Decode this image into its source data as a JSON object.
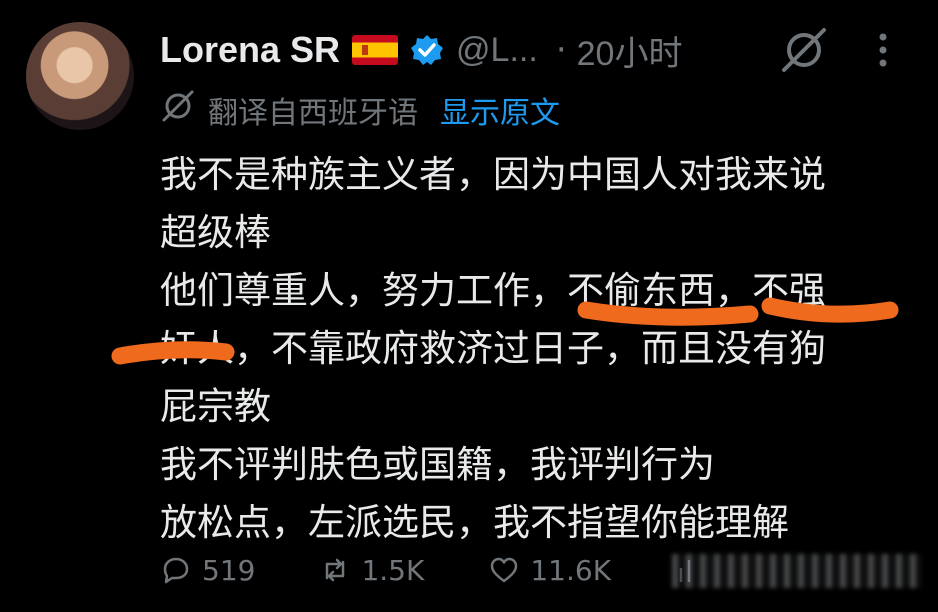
{
  "author": {
    "name": "Lorena SR",
    "handle": "@L...",
    "separator": "·",
    "time": "20小时"
  },
  "translation": {
    "note": "翻译自西班牙语",
    "show_original": "显示原文"
  },
  "body": {
    "lines": [
      "我不是种族主义者，因为中国人对我来说",
      "超级棒",
      "他们尊重人，努力工作，不偷东西，不强",
      "奸人，不靠政府救济过日子，而且没有狗",
      "屁宗教",
      "我不评判肤色或国籍，我评判行为",
      "放松点，左派选民，我不指望你能理解"
    ]
  },
  "actions": {
    "replies": "519",
    "reposts": "1.5K",
    "likes": "11.6K"
  },
  "icons": [
    "avatar",
    "spain-flag-icon",
    "verified-badge-icon",
    "grok-icon",
    "more-icon",
    "translate-icon",
    "reply-icon",
    "repost-icon",
    "like-icon",
    "views-icon"
  ],
  "colors": {
    "background": "#000000",
    "text": "#e7e9ea",
    "muted": "#71767b",
    "link": "#1d9bf0",
    "verified": "#1d9bf0",
    "highlight": "#f06a1e"
  }
}
